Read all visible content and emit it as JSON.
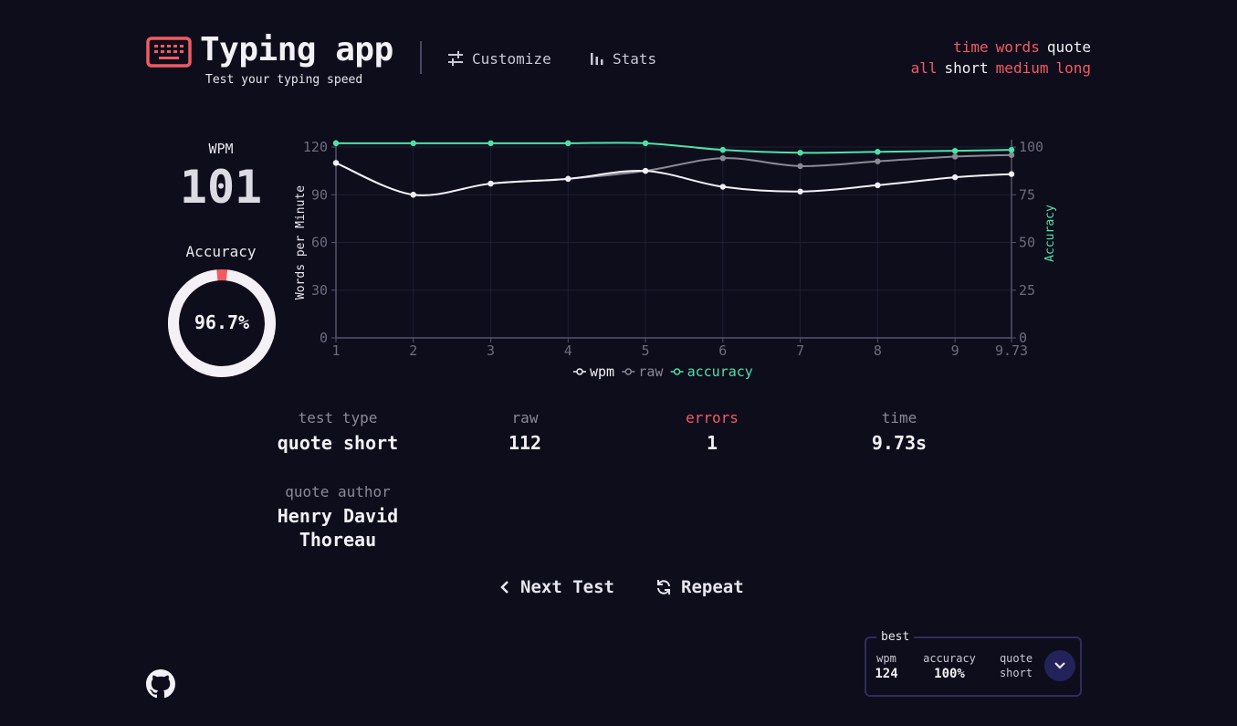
{
  "header": {
    "title": "Typing app",
    "subtitle": "Test your typing speed",
    "icons": {
      "logo": "keyboard-icon",
      "customize": "sliders-icon",
      "stats": "bar-chart-icon"
    },
    "nav": {
      "customize": "Customize",
      "stats": "Stats"
    },
    "modes": {
      "types": [
        {
          "label": "time",
          "active": false
        },
        {
          "label": "words",
          "active": false
        },
        {
          "label": "quote",
          "active": true
        }
      ],
      "lengths": [
        {
          "label": "all",
          "active": false
        },
        {
          "label": "short",
          "active": true
        },
        {
          "label": "medium",
          "active": false
        },
        {
          "label": "long",
          "active": false
        }
      ]
    }
  },
  "summary": {
    "wpm_label": "WPM",
    "wpm": "101",
    "accuracy_label": "Accuracy",
    "accuracy": "96.7%",
    "accuracy_fraction": 0.967
  },
  "chart_data": {
    "type": "line",
    "x": [
      1,
      2,
      3,
      4,
      5,
      6,
      7,
      8,
      9,
      9.73
    ],
    "x_tick_labels": [
      "1",
      "2",
      "3",
      "4",
      "5",
      "6",
      "7",
      "8",
      "9",
      "9.73"
    ],
    "ylabel": "Words per Minute",
    "ylim": [
      0,
      120
    ],
    "y_ticks": [
      0,
      30,
      60,
      90,
      120
    ],
    "y2label": "Accuracy",
    "y2lim": [
      0,
      100
    ],
    "y2_ticks": [
      0,
      25,
      50,
      75,
      100
    ],
    "grid": true,
    "legend_position": "bottom",
    "series": [
      {
        "name": "wpm",
        "axis": "left",
        "color": "#f3f1f6",
        "values": [
          110,
          90,
          97,
          100,
          105,
          95,
          92,
          96,
          101,
          103
        ]
      },
      {
        "name": "raw",
        "axis": "left",
        "color": "#8b8996",
        "values": [
          110,
          90,
          97,
          100,
          105,
          113,
          108,
          111,
          114,
          115
        ]
      },
      {
        "name": "accuracy",
        "axis": "right",
        "color": "#4ee2a8",
        "values": [
          102,
          102,
          102,
          102,
          102,
          98.5,
          97,
          97.5,
          98,
          98.5
        ]
      }
    ]
  },
  "results": {
    "test_type_label": "test type",
    "test_type": "quote short",
    "raw_label": "raw",
    "raw": "112",
    "errors_label": "errors",
    "errors": "1",
    "time_label": "time",
    "time": "9.73s",
    "author_label": "quote author",
    "author_line1": "Henry David",
    "author_line2": "Thoreau"
  },
  "actions": {
    "next": "Next Test",
    "repeat": "Repeat"
  },
  "best": {
    "legend": "best",
    "wpm_label": "wpm",
    "wpm": "124",
    "accuracy_label": "accuracy",
    "accuracy": "100%",
    "mode_line1": "quote",
    "mode_line2": "short"
  },
  "colors": {
    "background": "#0e0d1c",
    "accent": "#f25b62",
    "text": "#f3f1f6",
    "muted": "#8b8996",
    "accuracy": "#4ee2a8",
    "best_border": "#2f2c5c"
  }
}
